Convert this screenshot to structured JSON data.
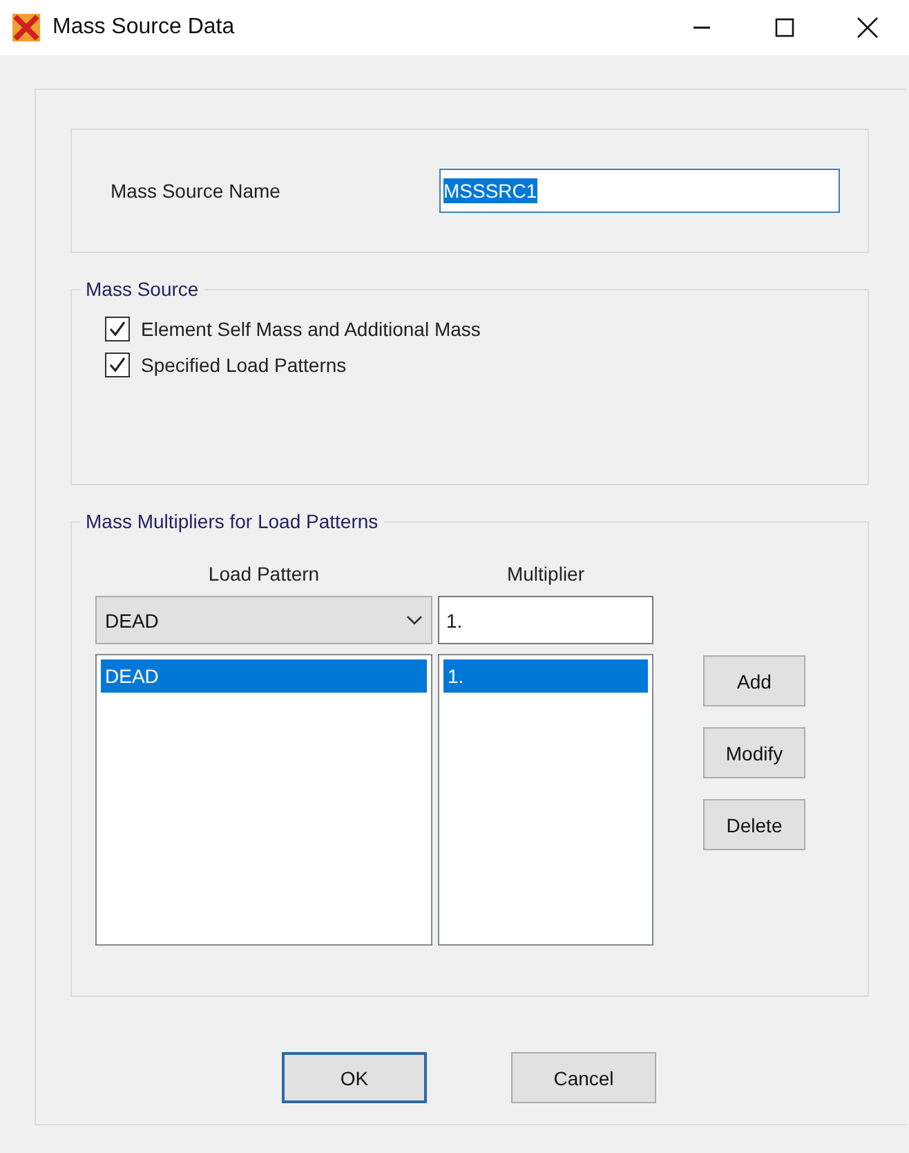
{
  "window": {
    "title": "Mass Source Data"
  },
  "name_field": {
    "label": "Mass Source Name",
    "value": "MSSSRC1"
  },
  "mass_source": {
    "legend": "Mass Source",
    "options": [
      {
        "label": "Element Self Mass and Additional Mass",
        "checked": true
      },
      {
        "label": "Specified Load Patterns",
        "checked": true
      }
    ]
  },
  "multipliers": {
    "legend": "Mass Multipliers for Load Patterns",
    "columns": [
      "Load Pattern",
      "Multiplier"
    ],
    "pattern_value": "DEAD",
    "multiplier_value": "1.",
    "rows": [
      {
        "pattern": "DEAD",
        "multiplier": "1.",
        "selected": true
      }
    ],
    "buttons": [
      "Add",
      "Modify",
      "Delete"
    ]
  },
  "buttons": [
    {
      "label": "OK",
      "default": true
    },
    {
      "label": "Cancel",
      "default": false
    }
  ]
}
